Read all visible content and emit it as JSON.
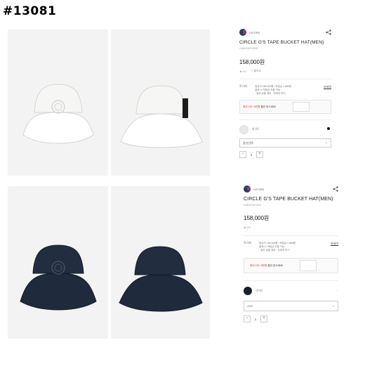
{
  "header": {
    "code": "#13081"
  },
  "photos": [
    {
      "name": "white-hat-front",
      "color": "#f2f2f0"
    },
    {
      "name": "white-hat-side",
      "color": "#f2f2f0"
    },
    {
      "name": "navy-hat-front",
      "color": "#1f2a3c"
    },
    {
      "name": "navy-hat-side",
      "color": "#1f2a3c"
    }
  ],
  "panel_top": {
    "brand": "G/FORE",
    "title": "CIRCLE G'S TAPE BUCKET HAT(MEN)",
    "product_code": "G4AS23H74WH",
    "price": "158,000원",
    "review": "★ 0.0",
    "wish": "♡ 좋아요",
    "shipping_label": "주/기타",
    "shipping_info_1": "정상가 158,000원 / 적립금 1,580원",
    "shipping_info_2": "결제 시 적립금 사용 가능",
    "shipping_info_3": "· 일부 상품 제외 · 자세히 보기",
    "shipping_link": "자세히",
    "promo_text_1": "최대 1만 / 5만원",
    "promo_text_2": " 할인 받으세요!",
    "color_name": "화이트",
    "option_placeholder": "옵션선택",
    "qty": "1"
  },
  "panel_bottom": {
    "brand": "G/FORE",
    "title": "CIRCLE G'S TAPE BUCKET HAT(MEN)",
    "product_code": "G4AS23H74NV",
    "price": "158,000원",
    "review": "★ 0.0",
    "shipping_label": "주/기타",
    "shipping_info_1": "정상가 158,000원 / 적립금 1,580원",
    "shipping_info_2": "결제 시 적립금 사용 가능",
    "shipping_info_3": "· 일부 상품 제외 · 자세히 보기",
    "shipping_link": "자세히",
    "promo_text_1": "최대 1만 / 5만원",
    "promo_text_2": " 할인 받으세요!",
    "color_name": "네이비",
    "option_placeholder": "XXX",
    "qty": "1"
  }
}
